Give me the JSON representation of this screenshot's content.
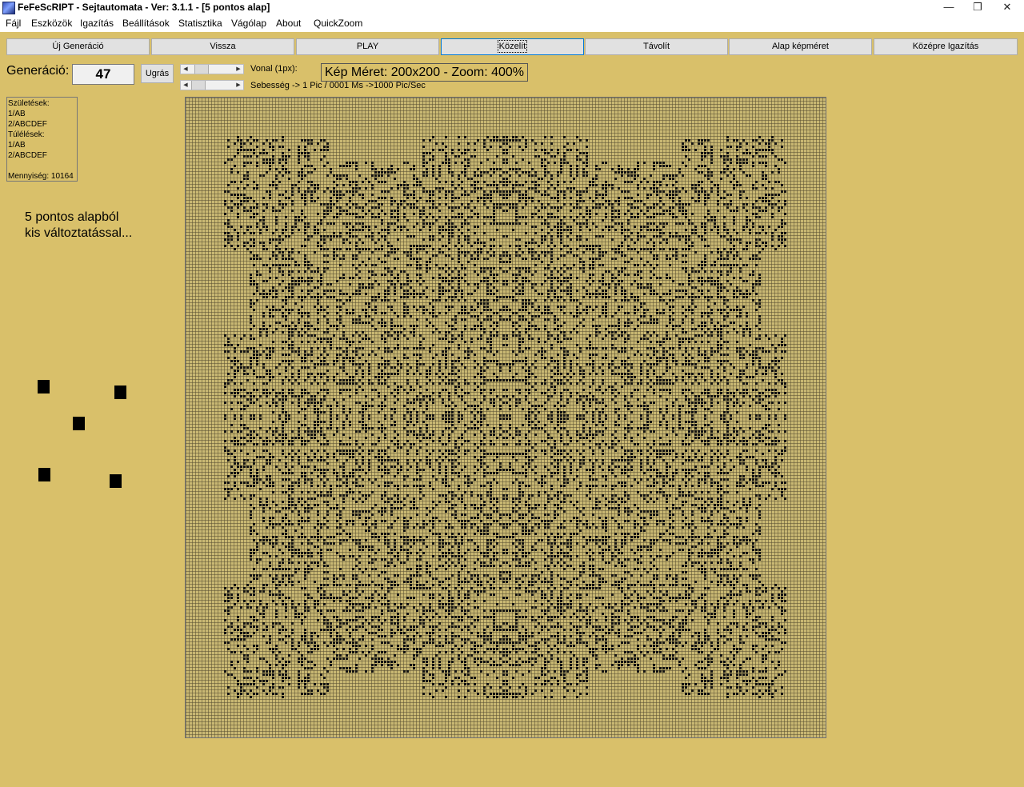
{
  "window": {
    "title": "FeFeScRIPT - Sejtautomata - Ver: 3.1.1 - [5 pontos alap]",
    "minimize_glyph": "—",
    "maximize_glyph": "❐",
    "close_glyph": "✕"
  },
  "menu": [
    "Fájl",
    "Eszközök",
    "Igazítás",
    "Beállítások",
    "Statisztika",
    "Vágólap",
    "About",
    "QuickZoom"
  ],
  "toolbar": [
    "Új Generáció",
    "Vissza",
    "PLAY",
    "Közelít",
    "Távolít",
    "Alap képméret",
    "Középre Igazítás"
  ],
  "generation": {
    "label": "Generáció:",
    "value": "47",
    "jump_button": "Ugrás"
  },
  "line_width": {
    "label": "Vonal (1px):"
  },
  "speed": {
    "label": "Sebesség -> 1 Pic / 0001 Ms ->1000 Pic/Sec"
  },
  "image_info": "Kép Méret: 200x200 - Zoom: 400%",
  "rules": {
    "births_label": "Születések:",
    "births": [
      "1/AB",
      "2/ABCDEF"
    ],
    "survivals_label": "Túlélések:",
    "survivals": [
      "1/AB",
      "2/ABCDEF"
    ],
    "count_label": "Mennyiség: 10164"
  },
  "note": [
    "5 pontos alapból",
    "kis változtatással..."
  ],
  "colors": {
    "background": "#d9c06a",
    "grid_cell": "#c9b873",
    "live_cell": "#111111"
  },
  "grid": {
    "size": "200x200",
    "zoom_percent": 400
  }
}
